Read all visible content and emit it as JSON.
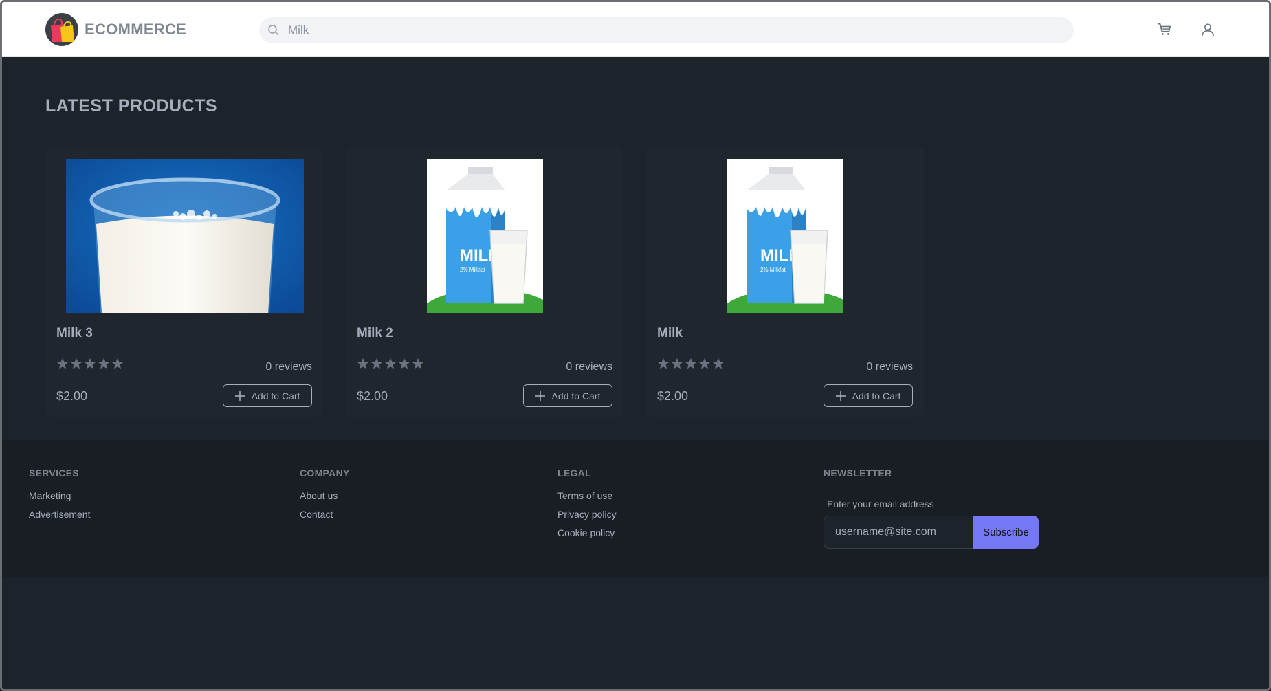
{
  "header": {
    "brand_name": "ECOMMERCE",
    "search": {
      "value": "Milk",
      "placeholder": "Search"
    }
  },
  "main": {
    "section_title": "LATEST PRODUCTS",
    "products": [
      {
        "name": "Milk 3",
        "reviews": "0 reviews",
        "price": "$2.00",
        "add_label": "Add to Cart",
        "rating": 0,
        "image": "glass-of-milk"
      },
      {
        "name": "Milk 2",
        "reviews": "0 reviews",
        "price": "$2.00",
        "add_label": "Add to Cart",
        "rating": 0,
        "image": "milk-carton-and-glass"
      },
      {
        "name": "Milk",
        "reviews": "0 reviews",
        "price": "$2.00",
        "add_label": "Add to Cart",
        "rating": 0,
        "image": "milk-carton-and-glass"
      }
    ],
    "carton_text": "MILK",
    "carton_subtext": "2% Milkfat"
  },
  "footer": {
    "services": {
      "title": "SERVICES",
      "links": [
        "Marketing",
        "Advertisement"
      ]
    },
    "company": {
      "title": "COMPANY",
      "links": [
        "About us",
        "Contact"
      ]
    },
    "legal": {
      "title": "LEGAL",
      "links": [
        "Terms of use",
        "Privacy policy",
        "Cookie policy"
      ]
    },
    "newsletter": {
      "title": "NEWSLETTER",
      "label": "Enter your email address",
      "placeholder": "username@site.com",
      "button": "Subscribe"
    }
  },
  "colors": {
    "accent": "#7478f5",
    "background": "#1d232a",
    "footer": "#191e24",
    "header": "#ffffff"
  }
}
